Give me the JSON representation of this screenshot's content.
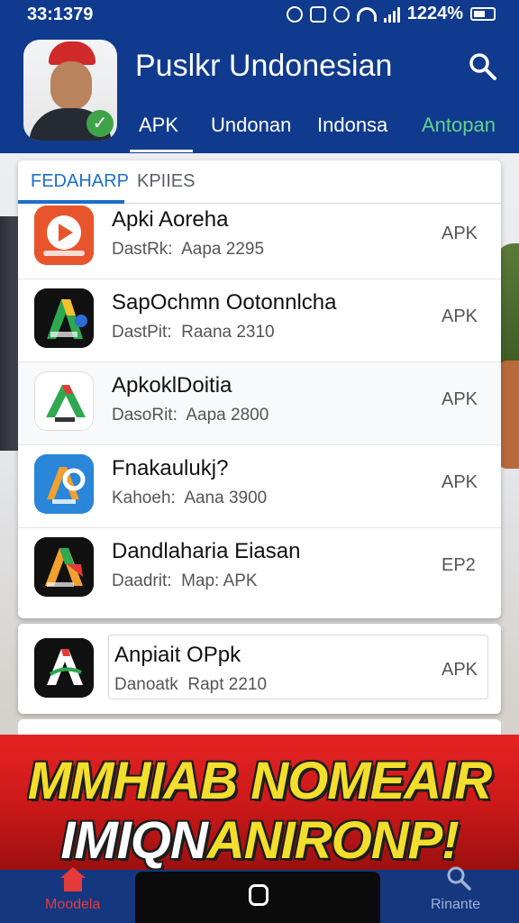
{
  "status_bar": {
    "time": "33:1379",
    "battery": "1224%"
  },
  "header": {
    "title": "Puslkr Undonesian",
    "tabs": [
      "APK",
      "Undonan",
      "Indonsa",
      "Antopan"
    ],
    "active_tab": 0
  },
  "list": {
    "tabs": [
      "FEDAHARP",
      "KPIIES"
    ],
    "items": [
      {
        "name": "Apki Aoreha",
        "meta_key": "DastRk:",
        "meta_val": "Aapa 2295",
        "tag": "APK"
      },
      {
        "name": "SapOchmn Ootonnlcha",
        "meta_key": "DastPit:",
        "meta_val": "Raana 2310",
        "tag": "APK"
      },
      {
        "name": "ApkoklDoitia",
        "meta_key": "DasoRit:",
        "meta_val": "Aapa 2800",
        "tag": "APK"
      },
      {
        "name": "Fnakaulukj?",
        "meta_key": "Kahoeh:",
        "meta_val": "Aana 3900",
        "tag": "APK"
      },
      {
        "name": "Dandlaharia Eiasan",
        "meta_key": "Daadrit:",
        "meta_val": "Map: APK",
        "tag": "EP2"
      }
    ]
  },
  "extra_item": {
    "name": "Anpiait OPpk",
    "meta_key": "Danoatk",
    "meta_val": "Rapt 2210",
    "tag": "APK"
  },
  "banner": {
    "line1": "MMHIAB NOMEAIR",
    "line2a": "IMIQN",
    "line2b": "ANIRONP!"
  },
  "bottom_nav": {
    "home_label": "Moodela",
    "search_label": "Rinante"
  },
  "colors": {
    "header_bg": "#0f3a8e",
    "accent_blue": "#1c6fc9",
    "tab_green": "#62d38a",
    "banner_red": "#d91c1c",
    "banner_yellow": "#f4de2c"
  }
}
